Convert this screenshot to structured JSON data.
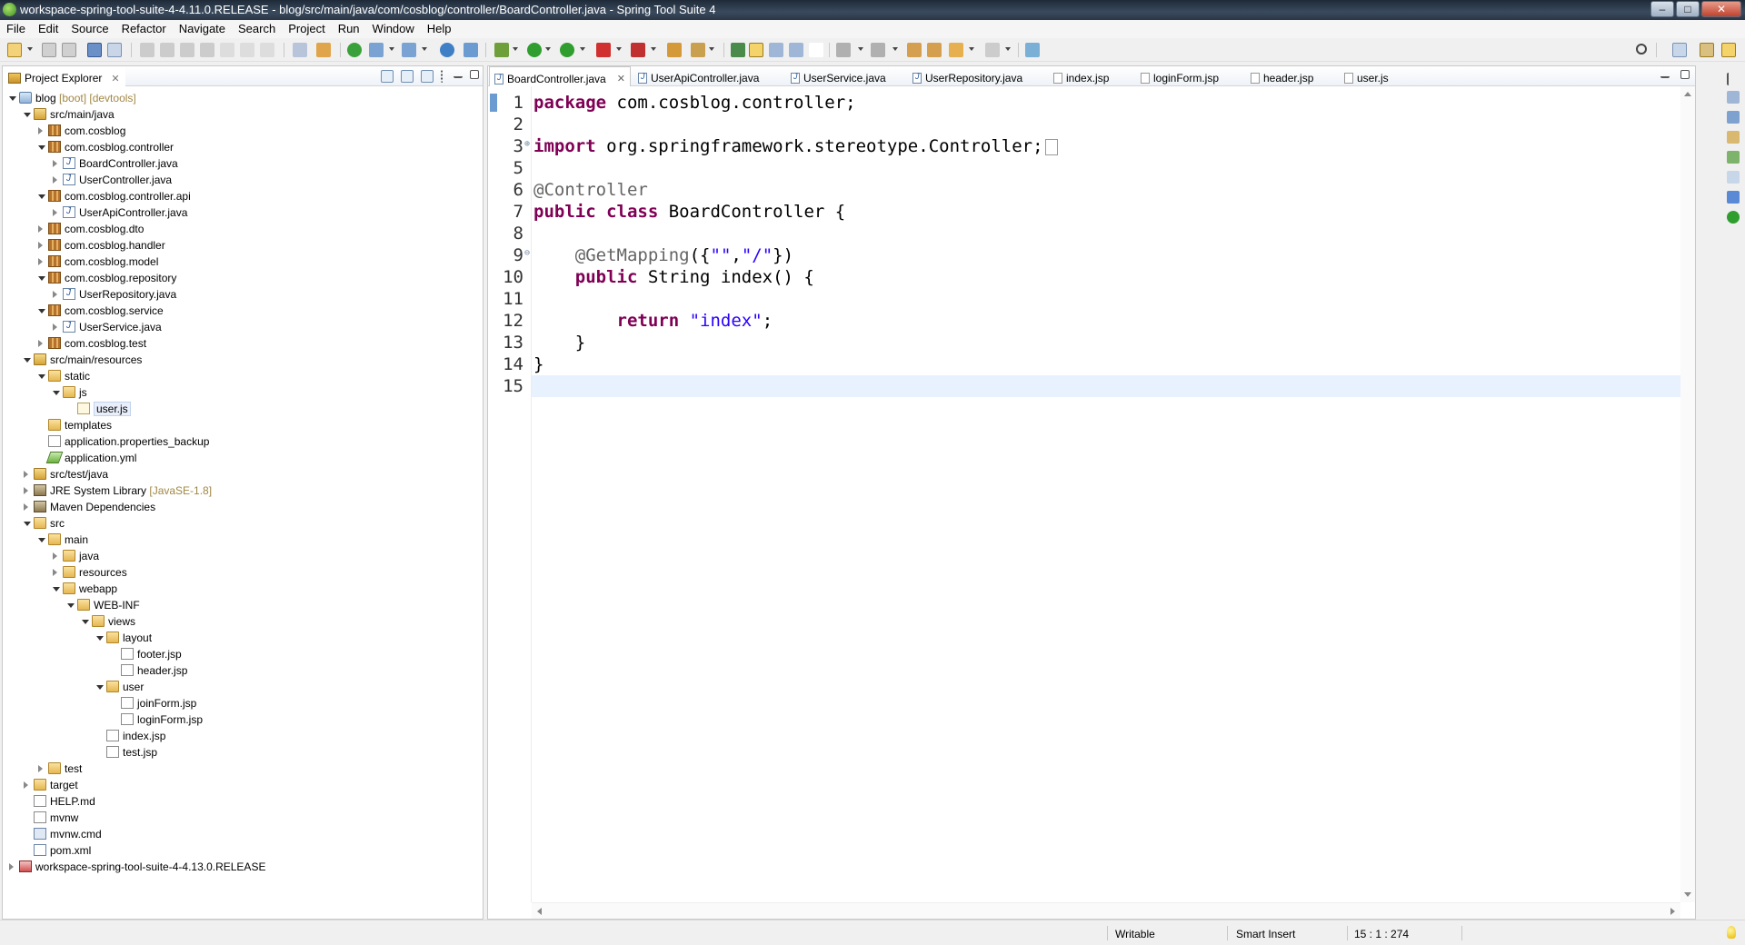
{
  "window": {
    "title": "workspace-spring-tool-suite-4-4.11.0.RELEASE - blog/src/main/java/com/cosblog/controller/BoardController.java - Spring Tool Suite 4",
    "buttons": {
      "minimize": "–",
      "maximize": "□",
      "close": "✕"
    }
  },
  "menu": [
    "File",
    "Edit",
    "Source",
    "Refactor",
    "Navigate",
    "Search",
    "Project",
    "Run",
    "Window",
    "Help"
  ],
  "explorer": {
    "title": "Project Explorer",
    "close": "✕",
    "tree": [
      {
        "label": "blog",
        "deco": " [boot] [devtools]"
      },
      {
        "label": "src/main/java"
      },
      {
        "label": "com.cosblog"
      },
      {
        "label": "com.cosblog.controller"
      },
      {
        "label": "BoardController.java"
      },
      {
        "label": "UserController.java"
      },
      {
        "label": "com.cosblog.controller.api"
      },
      {
        "label": "UserApiController.java"
      },
      {
        "label": "com.cosblog.dto"
      },
      {
        "label": "com.cosblog.handler"
      },
      {
        "label": "com.cosblog.model"
      },
      {
        "label": "com.cosblog.repository"
      },
      {
        "label": "UserRepository.java"
      },
      {
        "label": "com.cosblog.service"
      },
      {
        "label": "UserService.java"
      },
      {
        "label": "com.cosblog.test"
      },
      {
        "label": "src/main/resources"
      },
      {
        "label": "static"
      },
      {
        "label": "js"
      },
      {
        "label": "user.js"
      },
      {
        "label": "templates"
      },
      {
        "label": "application.properties_backup"
      },
      {
        "label": "application.yml"
      },
      {
        "label": "src/test/java"
      },
      {
        "label": "JRE System Library",
        "deco": " [JavaSE-1.8]"
      },
      {
        "label": "Maven Dependencies"
      },
      {
        "label": "src"
      },
      {
        "label": "main"
      },
      {
        "label": "java"
      },
      {
        "label": "resources"
      },
      {
        "label": "webapp"
      },
      {
        "label": "WEB-INF"
      },
      {
        "label": "views"
      },
      {
        "label": "layout"
      },
      {
        "label": "footer.jsp"
      },
      {
        "label": "header.jsp"
      },
      {
        "label": "user"
      },
      {
        "label": "joinForm.jsp"
      },
      {
        "label": "loginForm.jsp"
      },
      {
        "label": "index.jsp"
      },
      {
        "label": "test.jsp"
      },
      {
        "label": "test"
      },
      {
        "label": "target"
      },
      {
        "label": "HELP.md"
      },
      {
        "label": "mvnw"
      },
      {
        "label": "mvnw.cmd"
      },
      {
        "label": "pom.xml"
      },
      {
        "label": "workspace-spring-tool-suite-4-4.13.0.RELEASE"
      }
    ]
  },
  "editor": {
    "tabs": [
      "BoardController.java",
      "UserApiController.java",
      "UserService.java",
      "UserRepository.java",
      "index.jsp",
      "loginForm.jsp",
      "header.jsp",
      "user.js"
    ],
    "active_tab_close": "✕",
    "line_numbers": [
      "1",
      "2",
      "3",
      "5",
      "6",
      "7",
      "8",
      "9",
      "10",
      "11",
      "12",
      "13",
      "14",
      "15"
    ],
    "code": {
      "l1_kw": "package",
      "l1_rest": " com.cosblog.controller;",
      "l3_kw": "import",
      "l3_rest": " org.springframework.stereotype.Controller;",
      "l6_ann": "@Controller",
      "l7_kw1": "public",
      "l7_kw2": "class",
      "l7_rest": " BoardController {",
      "l9_ann": "@GetMapping",
      "l9_open": "({",
      "l9_s1": "\"\"",
      "l9_comma": ",",
      "l9_s2": "\"/\"",
      "l9_close": "})",
      "l10_kw": "public",
      "l10_rest": " String index() {",
      "l12_kw": "return",
      "l12_str": "\"index\"",
      "l12_end": ";",
      "l13": "}",
      "l14": "}"
    }
  },
  "status": {
    "writable": "Writable",
    "insert_mode": "Smart Insert",
    "position": "15 : 1 : 274"
  }
}
